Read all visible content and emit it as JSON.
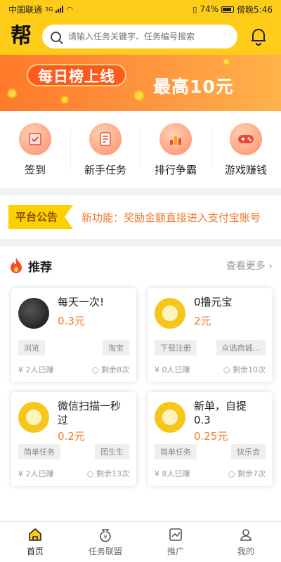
{
  "status": {
    "carrier": "中国联通",
    "network": "3G",
    "battery": "74%",
    "time": "傍晚5:46"
  },
  "header": {
    "logo": "帮",
    "search_placeholder": "请输入任务关键字、任务编号搜索"
  },
  "banner": {
    "left": "每日榜上线",
    "right": "最高10元"
  },
  "quick_nav": [
    {
      "label": "签到",
      "icon": "sign-in-icon"
    },
    {
      "label": "新手任务",
      "icon": "newbie-task-icon"
    },
    {
      "label": "排行争霸",
      "icon": "ranking-icon"
    },
    {
      "label": "游戏赚钱",
      "icon": "game-controller-icon"
    }
  ],
  "notice": {
    "tag": "平台公告",
    "text": "新功能：奖励金额直接进入支付宝账号"
  },
  "recommend": {
    "title": "推荐",
    "more": "查看更多",
    "cards": [
      {
        "title": "每天一次!",
        "price": "0.3元",
        "tags": [
          "浏览",
          "淘宝"
        ],
        "earned": "2人已赚",
        "remaining": "剩余8次"
      },
      {
        "title": "0撸元宝",
        "price": "2元",
        "tags": [
          "下载注册",
          "众选商城..."
        ],
        "earned": "0人已赚",
        "remaining": "剩余10次"
      },
      {
        "title": "微信扫描一秒过",
        "price": "0.2元",
        "tags": [
          "简单任务",
          "团生生"
        ],
        "earned": "2人已赚",
        "remaining": "剩余13次"
      },
      {
        "title": "新单，自提0.3",
        "price": "0.25元",
        "tags": [
          "简单任务",
          "快乐会"
        ],
        "earned": "8人已赚",
        "remaining": "剩余7次"
      }
    ]
  },
  "tabs": [
    {
      "label": "首页",
      "icon": "home-icon",
      "active": true
    },
    {
      "label": "任务联盟",
      "icon": "money-bag-icon",
      "active": false
    },
    {
      "label": "推广",
      "icon": "chart-icon",
      "active": false
    },
    {
      "label": "我的",
      "icon": "user-icon",
      "active": false
    }
  ],
  "colors": {
    "accent": "#ffcc1a",
    "price": "#f07a2a",
    "banner": "#ff7a2a"
  }
}
